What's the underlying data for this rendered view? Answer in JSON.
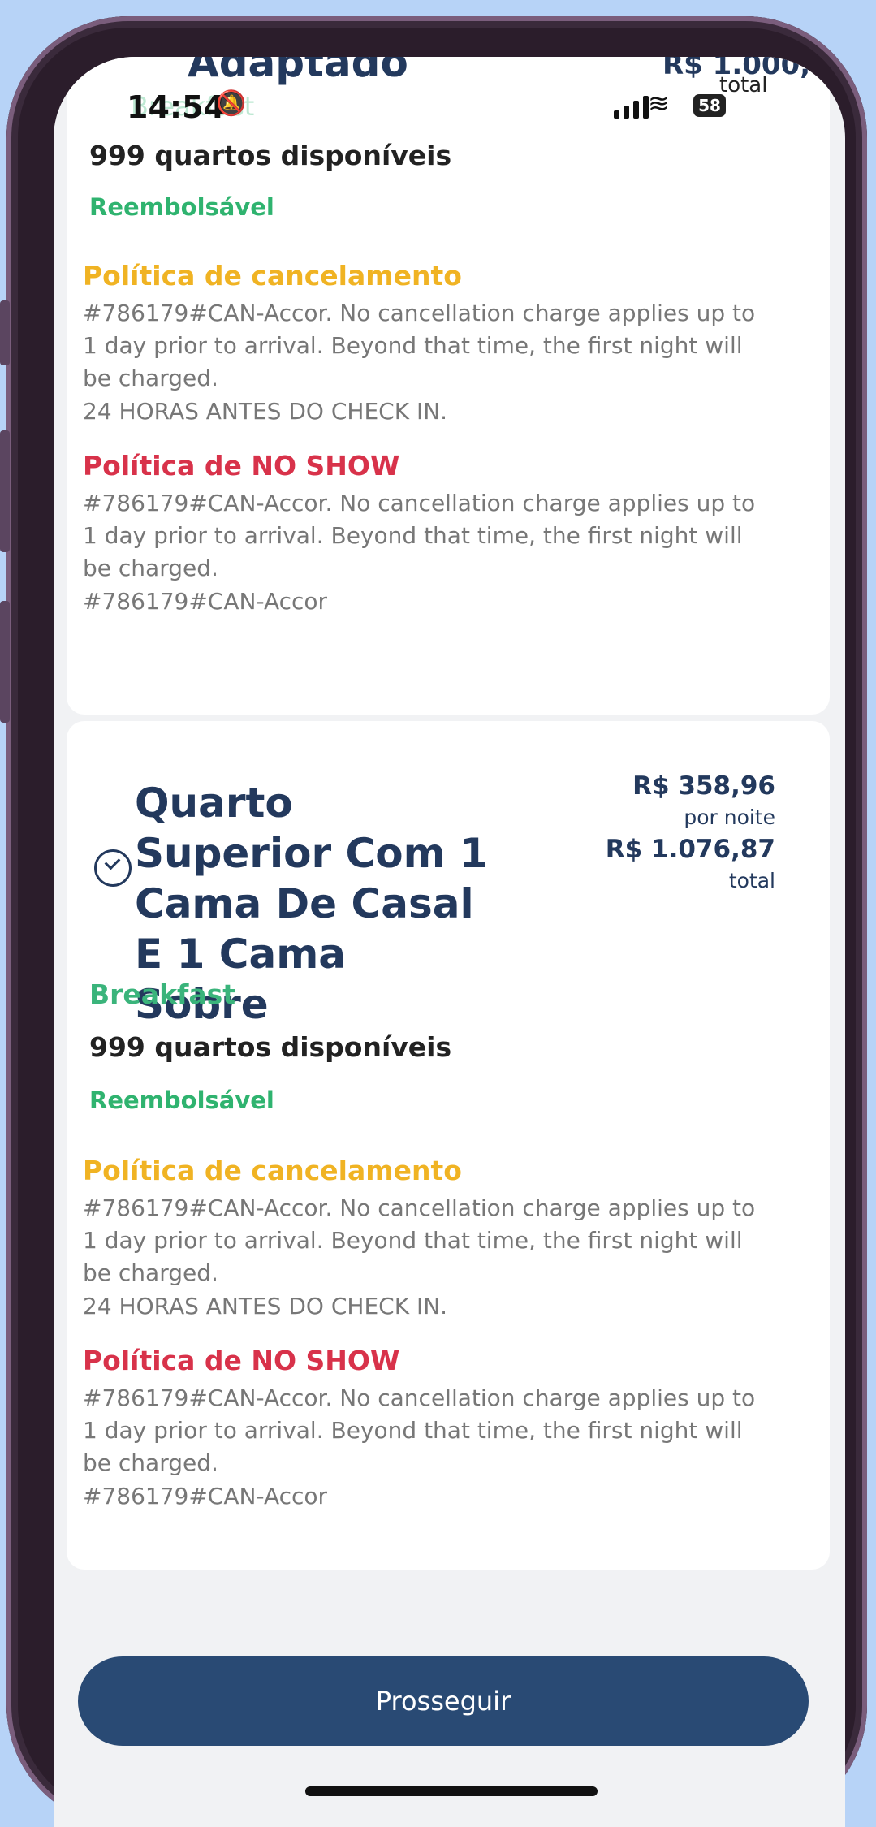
{
  "status": {
    "time": "14:54",
    "bell_icon": "bell-muted-icon",
    "battery": "58"
  },
  "prev_card": {
    "title_clip": "Adaptado",
    "price_clip": "R$ 1.000,",
    "total_label": "total",
    "breakfast_faded": "Breakfast",
    "availability": "999 quartos disponíveis",
    "refundable": "Reembolsável",
    "cancel_title": "Política de cancelamento",
    "cancel_text": "#786179#CAN-Accor. No cancellation charge applies up to 1 day prior to arrival. Beyond that time, the first night will be charged.",
    "cancel_sub": "24 HORAS ANTES DO CHECK IN.",
    "noshow_title": "Política de NO SHOW",
    "noshow_text": "#786179#CAN-Accor. No cancellation charge applies up to 1 day prior to arrival. Beyond that time, the first night will be charged.",
    "noshow_sub": "#786179#CAN-Accor"
  },
  "room": {
    "title": "Quarto Superior Com 1 Cama De Casal E 1 Cama Sobre",
    "price_per_night": "R$ 358,96",
    "per_night_label": "por noite",
    "price_total": "R$ 1.076,87",
    "total_label": "total",
    "meal": "Breakfast",
    "availability": "999 quartos disponíveis",
    "refundable": "Reembolsável",
    "cancel_title": "Política de cancelamento",
    "cancel_text": "#786179#CAN-Accor. No cancellation charge applies up to 1 day prior to arrival. Beyond that time, the first night will be charged.",
    "cancel_sub": "24 HORAS ANTES DO CHECK IN.",
    "noshow_title": "Política de NO SHOW",
    "noshow_text": "#786179#CAN-Accor. No cancellation charge applies up to 1 day prior to arrival. Beyond that time, the first night will be charged.",
    "noshow_sub": "#786179#CAN-Accor"
  },
  "cta": {
    "label": "Prosseguir"
  },
  "colors": {
    "primary": "#294a74",
    "refund": "#2fb36f",
    "cancel": "#f0b323",
    "noshow": "#d8324a"
  }
}
